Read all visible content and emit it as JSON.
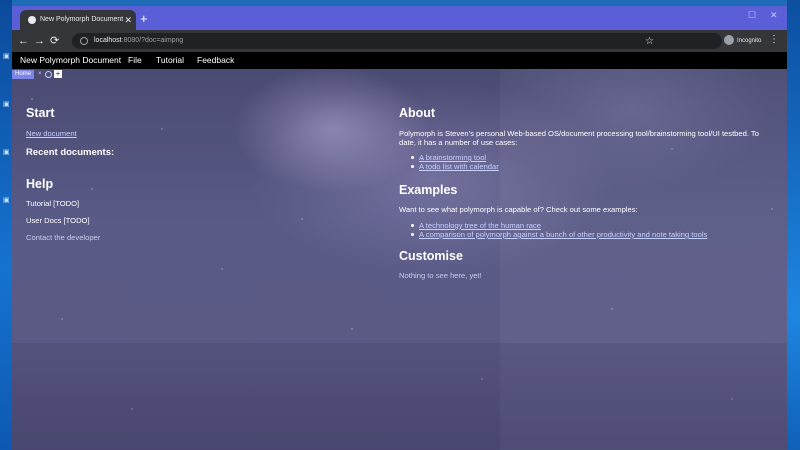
{
  "browser": {
    "tab_title": "New Polymorph Document - Pol",
    "tab_close": "✕",
    "new_tab": "+",
    "win_min": "—",
    "win_max": "☐",
    "win_close": "✕",
    "nav_back": "←",
    "nav_forward": "→",
    "nav_reload": "⟳",
    "url_host": "localhost",
    "url_path": ":8080/?doc=aimpng",
    "star": "☆",
    "incognito_label": "Incognito",
    "menu": "⋮"
  },
  "appbar": {
    "items": [
      "New Polymorph Document",
      "File",
      "Tutorial",
      "Feedback"
    ]
  },
  "home_tab": {
    "label": "Home",
    "close": "×",
    "add": "+"
  },
  "start": {
    "heading": "Start",
    "new_document": "New document",
    "recent_heading": "Recent documents:"
  },
  "help": {
    "heading": "Help",
    "tutorial": "Tutorial [TODO]",
    "user_docs": "User Docs [TODO]",
    "contact": "Contact the developer"
  },
  "about": {
    "heading": "About",
    "line1": "Polymorph is Steven's personal Web-based OS/document processing tool/brainstorming tool/UI testbed.  To",
    "line2": "date, it has a number of use cases:",
    "uses": [
      "A brainstorming tool",
      "A todo list with calendar"
    ]
  },
  "examples": {
    "heading": "Examples",
    "intro": "Want to see what polymorph is capable of? Check out some examples:",
    "items": [
      "A technology tree of the human race",
      "A comparison of polymorph against a bunch of other productivity and note taking tools"
    ]
  },
  "customise": {
    "heading": "Customise",
    "text": "Nothing to see here, yet!"
  }
}
